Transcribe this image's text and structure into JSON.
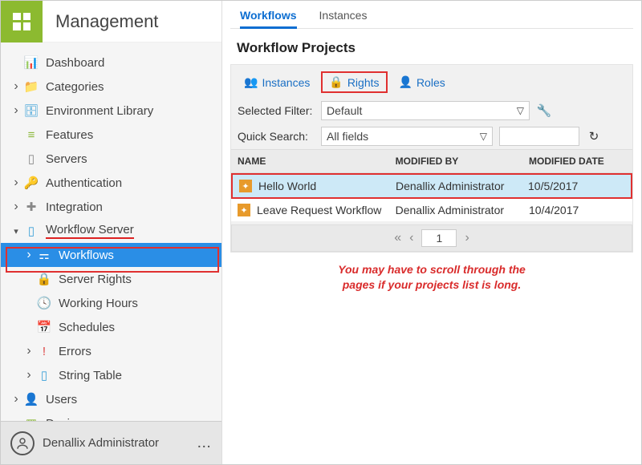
{
  "sidebar": {
    "title": "Management",
    "items": [
      {
        "label": "Dashboard",
        "chev": "none",
        "icon": "📊",
        "depth": 0
      },
      {
        "label": "Categories",
        "chev": "right",
        "icon": "📁",
        "depth": 0,
        "iconColor": "#e7a13a"
      },
      {
        "label": "Environment Library",
        "chev": "right",
        "icon": "🗄",
        "depth": 0,
        "iconColor": "#3aa0d8"
      },
      {
        "label": "Features",
        "chev": "none",
        "icon": "≡",
        "depth": 0,
        "iconColor": "#8bb83a"
      },
      {
        "label": "Servers",
        "chev": "none",
        "icon": "▯",
        "depth": 0,
        "iconColor": "#888"
      },
      {
        "label": "Authentication",
        "chev": "right",
        "icon": "🔑",
        "depth": 0,
        "iconColor": "#888"
      },
      {
        "label": "Integration",
        "chev": "right",
        "icon": "✚",
        "depth": 0,
        "iconColor": "#888"
      },
      {
        "label": "Workflow Server",
        "chev": "down",
        "icon": "▯",
        "depth": 0,
        "underline": true,
        "iconColor": "#3aa0d8"
      },
      {
        "label": "Workflows",
        "chev": "right",
        "icon": "⚎",
        "depth": 1,
        "active": true
      },
      {
        "label": "Server Rights",
        "chev": "none",
        "icon": "🔒",
        "depth": 1,
        "iconColor": "#e7a13a"
      },
      {
        "label": "Working Hours",
        "chev": "none",
        "icon": "🕓",
        "depth": 1,
        "iconColor": "#e7a13a"
      },
      {
        "label": "Schedules",
        "chev": "none",
        "icon": "📅",
        "depth": 1,
        "iconColor": "#56a7d8"
      },
      {
        "label": "Errors",
        "chev": "right",
        "icon": "!",
        "depth": 1,
        "iconColor": "#d44"
      },
      {
        "label": "String Table",
        "chev": "right",
        "icon": "▯",
        "depth": 1,
        "iconColor": "#3aa0d8"
      },
      {
        "label": "Users",
        "chev": "right",
        "icon": "👤",
        "depth": 0,
        "iconColor": "#888"
      },
      {
        "label": "Designer",
        "chev": "none",
        "icon": "▧",
        "depth": 0,
        "iconColor": "#8bb83a"
      }
    ],
    "footer": {
      "user": "Denallix Administrator",
      "more": "..."
    }
  },
  "main": {
    "tabs": [
      {
        "label": "Workflows",
        "active": true
      },
      {
        "label": "Instances",
        "active": false
      }
    ],
    "pageTitle": "Workflow Projects",
    "innerTabs": [
      {
        "label": "Instances",
        "icon": "👥",
        "highlight": false
      },
      {
        "label": "Rights",
        "icon": "🔒",
        "highlight": true,
        "iconColor": "#e7a13a"
      },
      {
        "label": "Roles",
        "icon": "👤",
        "highlight": false
      }
    ],
    "filter": {
      "label": "Selected Filter:",
      "value": "Default"
    },
    "search": {
      "label": "Quick Search:",
      "fieldsValue": "All fields",
      "input": ""
    },
    "columns": {
      "name": "NAME",
      "modifiedBy": "MODIFIED BY",
      "modifiedDate": "MODIFIED DATE"
    },
    "rows": [
      {
        "name": "Hello World",
        "modifiedBy": "Denallix Administrator",
        "modifiedDate": "10/5/2017",
        "selected": true
      },
      {
        "name": "Leave Request Workflow",
        "modifiedBy": "Denallix Administrator",
        "modifiedDate": "10/4/2017",
        "selected": false
      }
    ],
    "pager": {
      "page": "1"
    },
    "annotation": "You may have to scroll through the\npages if your projects list is long."
  }
}
